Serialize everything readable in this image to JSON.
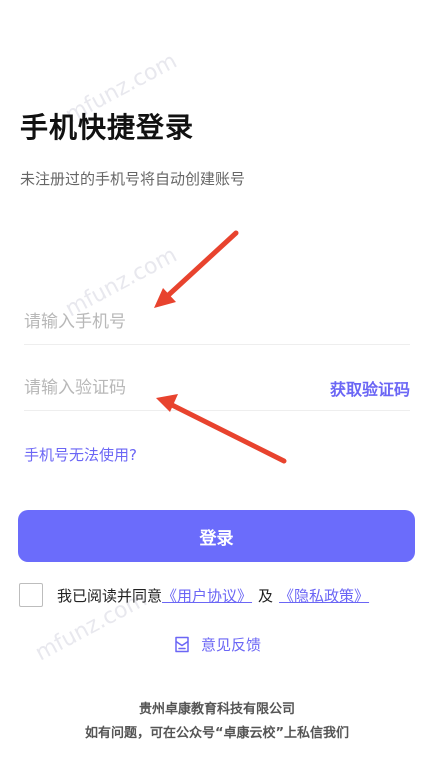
{
  "header": {
    "title": "手机快捷登录",
    "subtitle": "未注册过的手机号将自动创建账号"
  },
  "form": {
    "phone_placeholder": "请输入手机号",
    "phone_value": "",
    "code_placeholder": "请输入验证码",
    "code_value": "",
    "get_code_label": "获取验证码",
    "help_link": "手机号无法使用?",
    "login_label": "登录"
  },
  "agreement": {
    "prefix": "我已阅读并同意",
    "user_agreement": "《用户协议》",
    "conjunction": "及",
    "privacy_policy": "《隐私政策》",
    "checked": false
  },
  "feedback": {
    "label": "意见反馈",
    "icon": "feedback-icon"
  },
  "footer": {
    "company": "贵州卓康教育科技有限公司",
    "contact": "如有问题，可在公众号“卓康云校”上私信我们"
  },
  "watermark": "mfunz.com",
  "colors": {
    "accent": "#6b66f5",
    "button": "#6b6cfb",
    "annotation_arrow": "#e8432e"
  }
}
